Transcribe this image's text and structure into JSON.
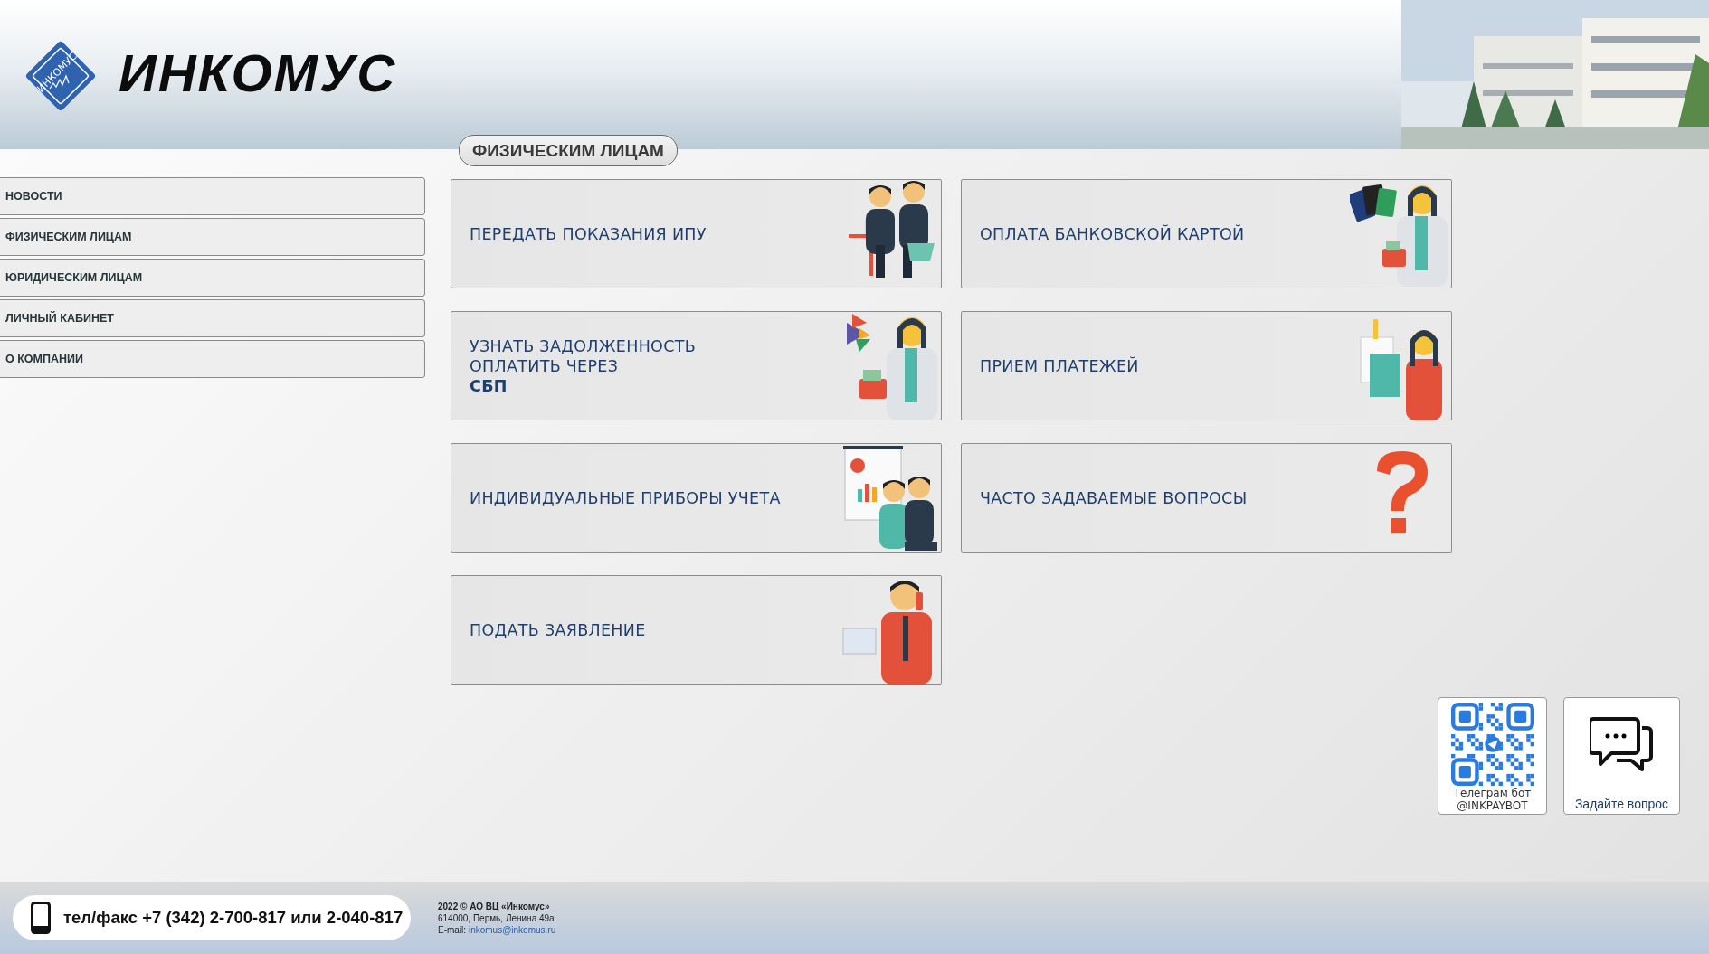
{
  "header": {
    "logo": {
      "emblem_text": "ИНКОМУС",
      "wordmark": "ИНКОМУС"
    }
  },
  "section_title": "ФИЗИЧЕСКИМ ЛИЦАМ",
  "sidebar": {
    "items": [
      {
        "label": "НОВОСТИ"
      },
      {
        "label": "ФИЗИЧЕСКИМ ЛИЦАМ"
      },
      {
        "label": "ЮРИДИЧЕСКИМ ЛИЦАМ"
      },
      {
        "label": "ЛИЧНЫЙ КАБИНЕТ"
      },
      {
        "label": "О КОМПАНИИ"
      }
    ]
  },
  "cards": [
    {
      "lines": [
        "ПЕРЕДАТЬ ПОКАЗАНИЯ ИПУ"
      ],
      "kind": "meeting"
    },
    {
      "lines": [
        "ОПЛАТА БАНКОВСКОЙ КАРТОЙ"
      ],
      "kind": "cards"
    },
    {
      "lines": [
        "УЗНАТЬ ЗАДОЛЖЕННОСТЬ",
        "ОПЛАТИТЬ ЧЕРЕЗ",
        "**СБП**"
      ],
      "kind": "sbp"
    },
    {
      "lines": [
        "ПРИЕМ ПЛАТЕЖЕЙ"
      ],
      "kind": "shopping"
    },
    {
      "lines": [
        "ИНДИВИДУАЛЬНЫЕ ПРИБОРЫ УЧЕТА"
      ],
      "kind": "presentation"
    },
    {
      "lines": [
        "ЧАСТО ЗАДАВАЕМЫЕ ВОПРОСЫ"
      ],
      "kind": "question"
    },
    {
      "lines": [
        "ПОДАТЬ ЗАЯВЛЕНИЕ"
      ],
      "kind": "phone"
    }
  ],
  "widgets": [
    {
      "kind": "qr",
      "lines": [
        "Телеграм бот",
        "@INKPAYBOT"
      ]
    },
    {
      "kind": "chat",
      "lines": [
        "Задайте вопрос"
      ]
    }
  ],
  "footer": {
    "phone": "тел/факс +7 (342) 2-700-817 или 2-040-817",
    "copyright": "2022 © АО ВЦ «Инкомус»",
    "address": "614000, Пермь, Ленина 49а",
    "email_label": "E-mail:",
    "email": "inkomus@inkomus.ru"
  }
}
